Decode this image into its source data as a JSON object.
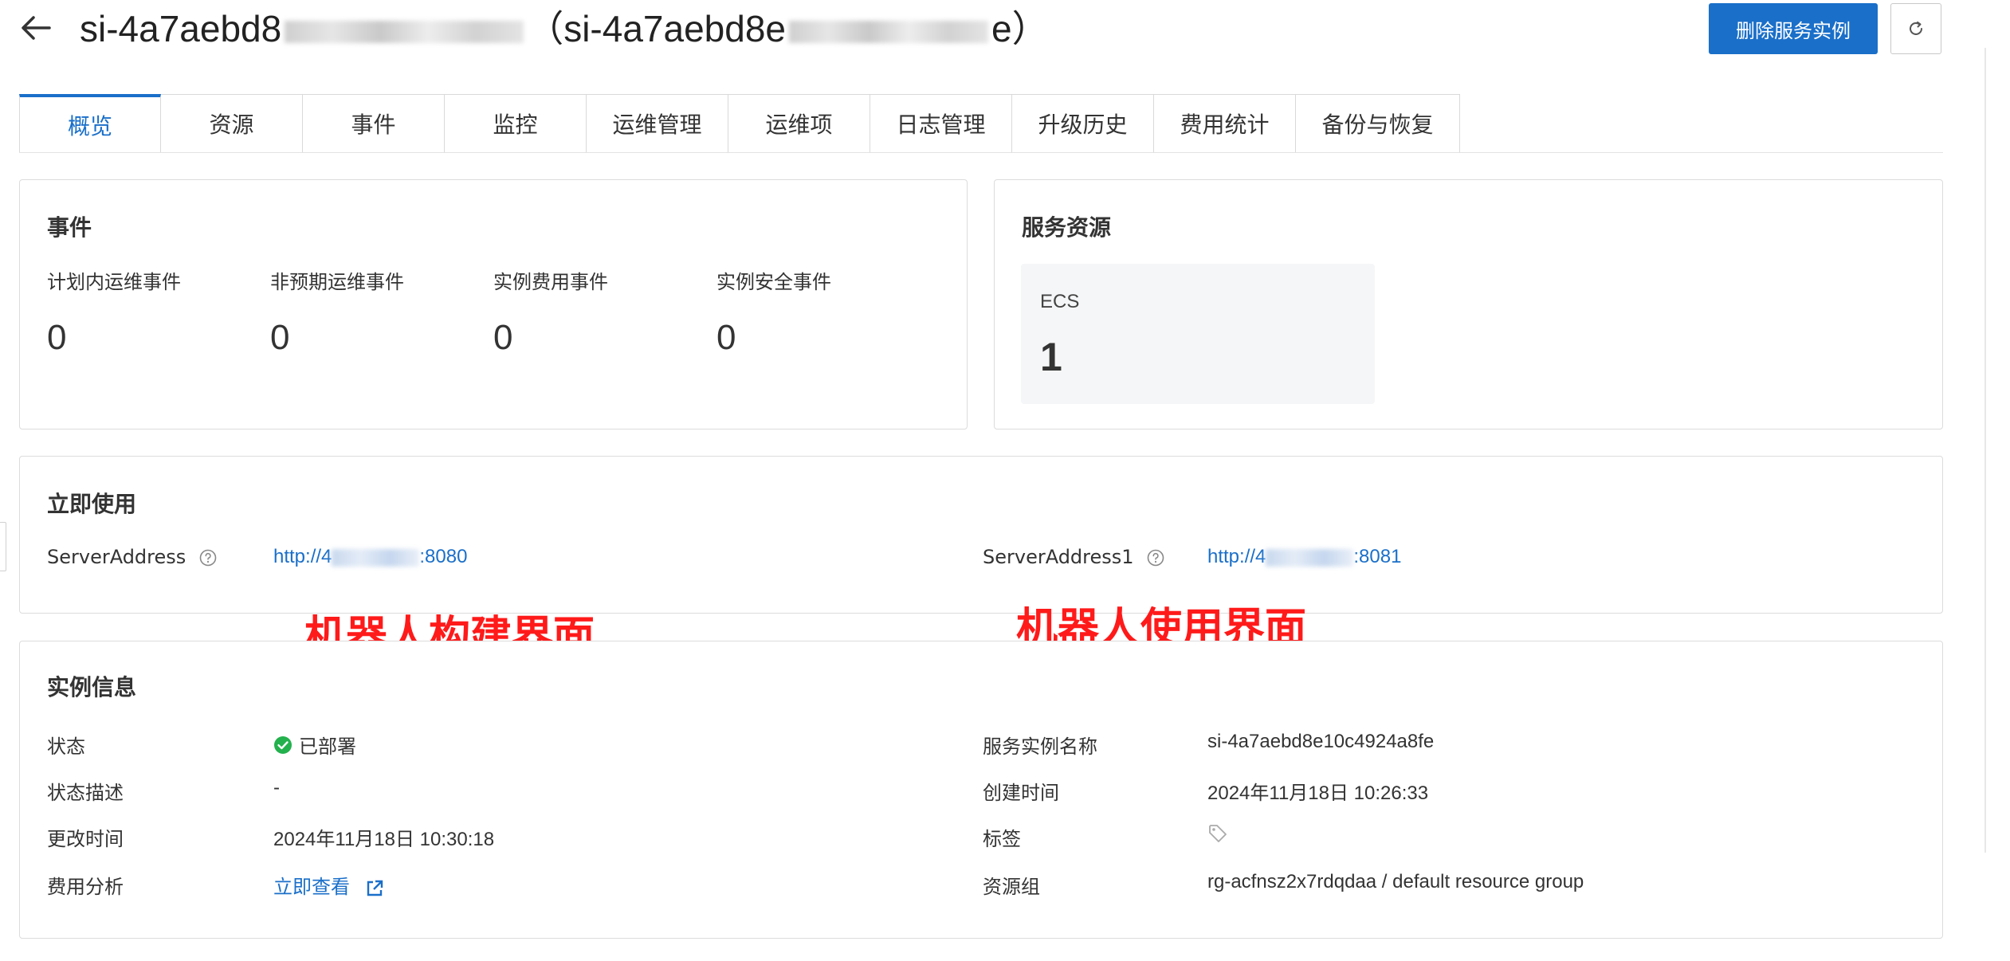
{
  "header": {
    "title_prefix": "si-4a7aebd8",
    "title_paren_open": "（si-4a7aebd8e",
    "title_paren_close": "e）",
    "delete_button": "删除服务实例"
  },
  "tabs": [
    {
      "label": "概览",
      "active": true
    },
    {
      "label": "资源"
    },
    {
      "label": "事件"
    },
    {
      "label": "监控"
    },
    {
      "label": "运维管理"
    },
    {
      "label": "运维项"
    },
    {
      "label": "日志管理"
    },
    {
      "label": "升级历史"
    },
    {
      "label": "费用统计"
    },
    {
      "label": "备份与恢复"
    }
  ],
  "events": {
    "title": "事件",
    "items": [
      {
        "label": "计划内运维事件",
        "value": "0"
      },
      {
        "label": "非预期运维事件",
        "value": "0"
      },
      {
        "label": "实例费用事件",
        "value": "0"
      },
      {
        "label": "实例安全事件",
        "value": "0"
      }
    ]
  },
  "resources": {
    "title": "服务资源",
    "ecs_label": "ECS",
    "ecs_value": "1"
  },
  "use_now": {
    "title": "立即使用",
    "address1_label": "ServerAddress",
    "address1_prefix": "http://4",
    "address1_suffix": ":8080",
    "address2_label": "ServerAddress1",
    "address2_prefix": "http://4",
    "address2_suffix": ":8081"
  },
  "annotations": {
    "left": "机器人构建界面",
    "right": "机器人使用界面"
  },
  "instance_info": {
    "title": "实例信息",
    "status_label": "状态",
    "status_value": "已部署",
    "status_desc_label": "状态描述",
    "status_desc_value": "-",
    "modified_label": "更改时间",
    "modified_value": "2024年11月18日 10:30:18",
    "cost_label": "费用分析",
    "cost_link": "立即查看",
    "name_label": "服务实例名称",
    "name_value": "si-4a7aebd8e10c4924a8fe",
    "created_label": "创建时间",
    "created_value": "2024年11月18日 10:26:33",
    "tags_label": "标签",
    "rg_label": "资源组",
    "rg_value": "rg-acfnsz2x7rdqdaa / default resource group"
  },
  "colors": {
    "primary": "#1a6fc9",
    "annotation": "#ff1a1a",
    "success": "#23b14d"
  }
}
